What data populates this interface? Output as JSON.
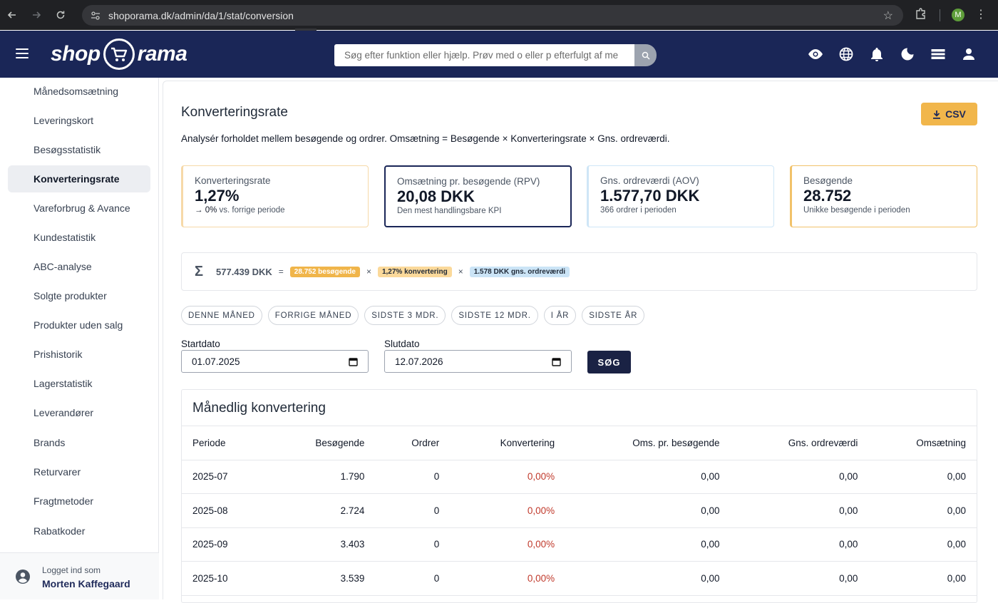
{
  "browser": {
    "url": "shoporama.dk/admin/da/1/stat/conversion",
    "profile_initial": "M"
  },
  "header": {
    "logo_left": "shop",
    "logo_right": "rama",
    "search_placeholder": "Søg efter funktion eller hjælp. Prøv med o eller p efterfulgt af me",
    "icons": [
      "eye-icon",
      "globe-icon",
      "bell-icon",
      "moon-icon",
      "card-icon",
      "user-icon"
    ]
  },
  "sidebar": {
    "items": [
      {
        "label": "Månedsomsætning",
        "active": false
      },
      {
        "label": "Leveringskort",
        "active": false
      },
      {
        "label": "Besøgsstatistik",
        "active": false
      },
      {
        "label": "Konverteringsrate",
        "active": true
      },
      {
        "label": "Vareforbrug & Avance",
        "active": false
      },
      {
        "label": "Kundestatistik",
        "active": false
      },
      {
        "label": "ABC-analyse",
        "active": false
      },
      {
        "label": "Solgte produkter",
        "active": false
      },
      {
        "label": "Produkter uden salg",
        "active": false
      },
      {
        "label": "Prishistorik",
        "active": false
      },
      {
        "label": "Lagerstatistik",
        "active": false
      },
      {
        "label": "Leverandører",
        "active": false
      },
      {
        "label": "Brands",
        "active": false
      },
      {
        "label": "Returvarer",
        "active": false
      },
      {
        "label": "Fragtmetoder",
        "active": false
      },
      {
        "label": "Rabatkoder",
        "active": false
      }
    ],
    "footer": {
      "logged_in_label": "Logget ind som",
      "user_name": "Morten Kaffegaard"
    }
  },
  "main": {
    "title": "Konverteringsrate",
    "csv_label": "CSV",
    "description": "Analysér forholdet mellem besøgende og ordrer. Omsætning = Besøgende × Konverteringsrate × Gns. ordreværdi.",
    "kpis": [
      {
        "label": "Konverteringsrate",
        "value": "1,27%",
        "sub_strong": "→ 0%",
        "sub": "vs. forrige periode"
      },
      {
        "label": "Omsætning pr. besøgende (RPV)",
        "value": "20,08 DKK",
        "sub": "Den mest handlingsbare KPI"
      },
      {
        "label": "Gns. ordreværdi (AOV)",
        "value": "1.577,70 DKK",
        "sub": "366 ordrer i perioden"
      },
      {
        "label": "Besøgende",
        "value": "28.752",
        "sub": "Unikke besøgende i perioden"
      }
    ],
    "formula": {
      "sigma": "Σ",
      "total": "577.439 DKK",
      "equals": "=",
      "times": "×",
      "visitors": "28.752 besøgende",
      "conversion": "1,27% konvertering",
      "aov": "1.578 DKK gns. ordreværdi"
    },
    "presets": [
      "DENNE MÅNED",
      "FORRIGE MÅNED",
      "SIDSTE 3 MDR.",
      "SIDSTE 12 MDR.",
      "I ÅR",
      "SIDSTE ÅR"
    ],
    "start_label": "Startdato",
    "start_value": "01.07.2025",
    "end_label": "Slutdato",
    "end_value": "12.07.2026",
    "search_label": "SØG",
    "table": {
      "title": "Månedlig konvertering",
      "columns": [
        "Periode",
        "Besøgende",
        "Ordrer",
        "Konvertering",
        "Oms. pr. besøgende",
        "Gns. ordreværdi",
        "Omsætning"
      ],
      "rows": [
        [
          "2025-07",
          "1.790",
          "0",
          "0,00%",
          "0,00",
          "0,00",
          "0,00"
        ],
        [
          "2025-08",
          "2.724",
          "0",
          "0,00%",
          "0,00",
          "0,00",
          "0,00"
        ],
        [
          "2025-09",
          "3.403",
          "0",
          "0,00%",
          "0,00",
          "0,00",
          "0,00"
        ],
        [
          "2025-10",
          "3.539",
          "0",
          "0,00%",
          "0,00",
          "0,00",
          "0,00"
        ]
      ]
    }
  },
  "colors": {
    "appbar": "#1a2657",
    "accent": "#f1b64b",
    "danger": "#c0392b"
  }
}
